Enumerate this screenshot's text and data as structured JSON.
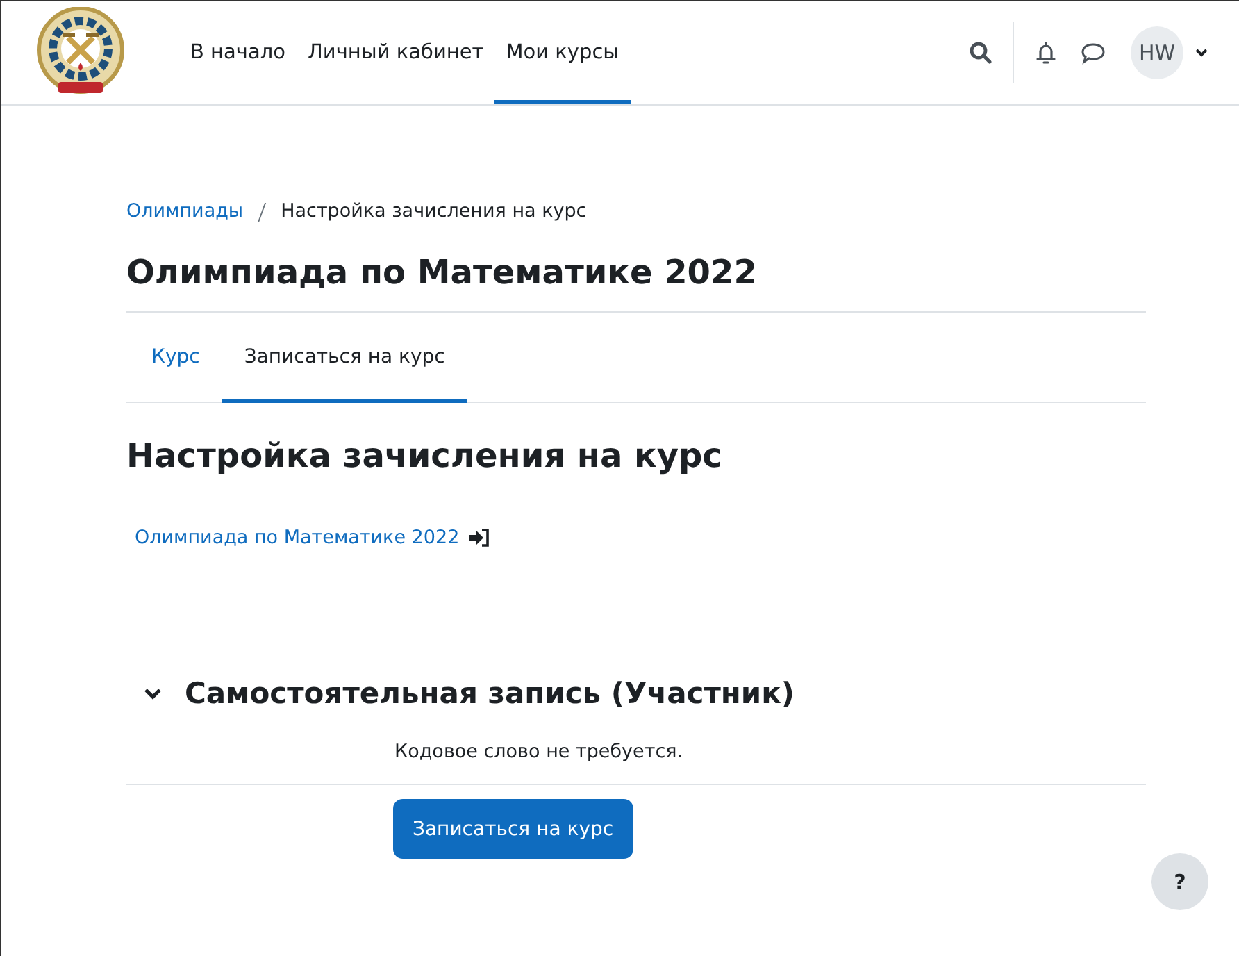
{
  "navbar": {
    "items": [
      {
        "label": "В начало",
        "selected": false
      },
      {
        "label": "Личный кабинет",
        "selected": false
      },
      {
        "label": "Мои курсы",
        "selected": true
      }
    ],
    "user": {
      "initials": "HW"
    }
  },
  "breadcrumb": [
    "Олимпиады",
    "Настройка зачисления на курс"
  ],
  "course_title": "Олимпиада по Математике 2022",
  "tabs": [
    {
      "label": "Курс",
      "selected": false
    },
    {
      "label": "Записаться на курс",
      "selected": true
    }
  ],
  "page_heading": "Настройка зачисления на курс",
  "course_link": "Олимпиада по Математике 2022",
  "enrol_section": {
    "title": "Самостоятельная запись (Участник)",
    "expanded": true,
    "note": "Кодовое слово не требуется.",
    "button": "Записаться на курс"
  },
  "help_button": "?"
}
